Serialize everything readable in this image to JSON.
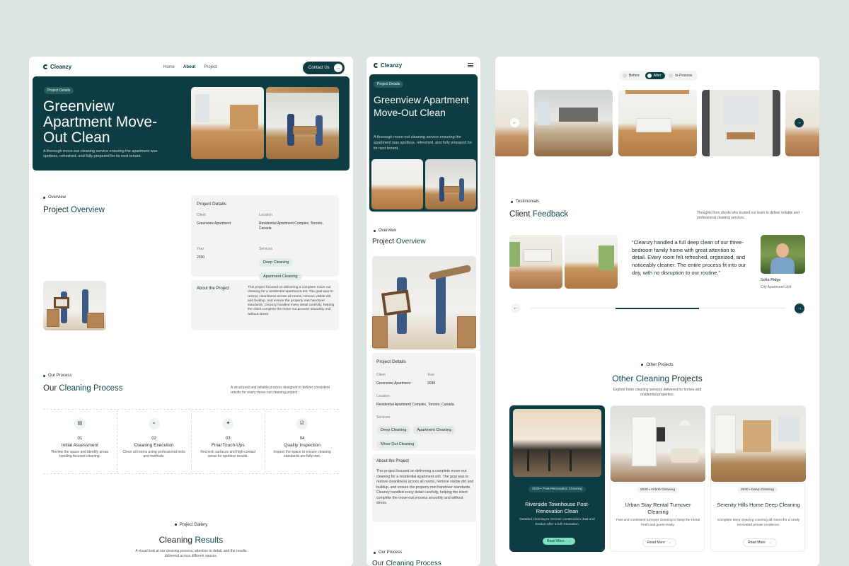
{
  "brand": {
    "name": "Cleanzy"
  },
  "nav": {
    "home": "Home",
    "about": "About",
    "project": "Project",
    "contact": "Contact Us"
  },
  "hero": {
    "badge": "Project Details",
    "title": "Greenview Apartment Move-Out Clean",
    "description": "A thorough move-out cleaning service ensuring the apartment was spotless, refreshed, and fully prepared for its next tenant."
  },
  "overview": {
    "tag": "Overview",
    "title_a": "Project ",
    "title_b": "Overview",
    "details_title": "Project Details",
    "client_label": "Client",
    "client_value": "Greenview Apartment",
    "location_label": "Location",
    "location_value": "Residential Apartment Complex, Toronto, Canada",
    "year_label": "Year",
    "year_value": "2030",
    "services_label": "Services",
    "services": [
      "Deep Cleaning",
      "Apartment Cleaning",
      "Move-Out Cleaning"
    ],
    "about_title": "About the Project",
    "about_text": "This project focused on delivering a complete move-out cleaning for a residential apartment unit. The goal was to restore cleanliness across all rooms, remove visible dirt and buildup, and ensure the property met handover standards. Cleanzy handled every detail carefully, helping the client complete the move-out process smoothly and without stress."
  },
  "process": {
    "tag": "Our Process",
    "title_a": "Our ",
    "title_b": "Cleaning Process",
    "description": "A structured and reliable process designed to deliver consistent results for every move-out cleaning project.",
    "steps": [
      {
        "num": "01",
        "title": "Initial Assessment",
        "text": "Review the space and identify areas needing focused cleaning.",
        "icon": "clipboard-icon"
      },
      {
        "num": "02",
        "title": "Cleaning Execution",
        "text": "Clean all rooms using professional tools and methods.",
        "icon": "broom-icon"
      },
      {
        "num": "03",
        "title": "Final Touch-Ups",
        "text": "Recheck surfaces and high-contact areas for spotless results.",
        "icon": "sparkle-icon"
      },
      {
        "num": "04",
        "title": "Quality Inspection",
        "text": "Inspect the space to ensure cleaning standards are fully met.",
        "icon": "checklist-icon"
      }
    ]
  },
  "gallery": {
    "tag": "Project Gallery",
    "title_a": "Cleaning ",
    "title_b": "Results",
    "description": "A visual look at our cleaning process, attention to detail, and the results delivered across different spaces.",
    "toggles": [
      "Before",
      "After",
      "In-Process"
    ],
    "active_toggle": "After"
  },
  "testimonials": {
    "tag": "Testimonials",
    "title_a": "Client ",
    "title_b": "Feedback",
    "description": "Thoughts from clients who trusted our team to deliver reliable and professional cleaning services.",
    "quote": "“Cleanzy handled a full deep clean of our three-bedroom family home with great attention to detail. Every room felt refreshed, organized, and noticeably cleaner. The entire process fit into our day, with no disruption to our routine.”",
    "author": "Sofia Ridge",
    "author_role": "City Apartment Unit",
    "progress": 0.33
  },
  "other": {
    "tag": "Other Projects",
    "title_a": "Other Cleaning ",
    "title_b": "Projects",
    "description": "Explore more cleaning services delivered for homes and residential properties.",
    "cards": [
      {
        "meta": "2029 • Post-Renovation Cleaning",
        "title": "Riverside Townhouse Post-Renovation Clean",
        "text": "Detailed cleaning to remove construction dust and residue after a full renovation.",
        "button": "Read More"
      },
      {
        "meta": "2030 • Airbnb Cleaning",
        "title": "Urban Stay Rental Turnover Cleaning",
        "text": "Fast and consistent turnover cleaning to keep the rental fresh and guest-ready.",
        "button": "Read More"
      },
      {
        "meta": "2030 • Deep Cleaning",
        "title": "Serenity Hills Home Deep Cleaning",
        "text": "Complete deep cleaning covering all rooms for a newly renovated private residence.",
        "button": "Read More"
      }
    ]
  }
}
